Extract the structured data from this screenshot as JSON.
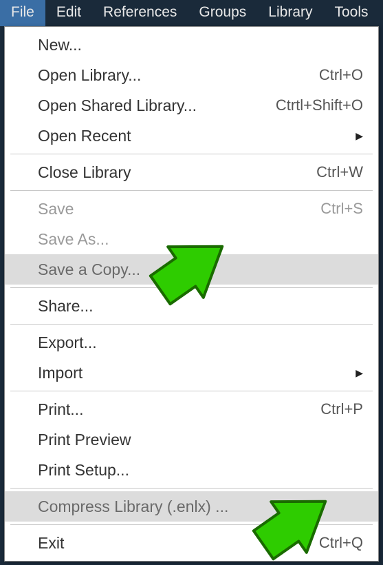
{
  "menubar": {
    "items": [
      {
        "label": "File",
        "active": true
      },
      {
        "label": "Edit",
        "active": false
      },
      {
        "label": "References",
        "active": false
      },
      {
        "label": "Groups",
        "active": false
      },
      {
        "label": "Library",
        "active": false
      },
      {
        "label": "Tools",
        "active": false
      }
    ]
  },
  "dropdown": {
    "items": [
      {
        "label": "New...",
        "shortcut": "",
        "submenu": false,
        "disabled": false,
        "highlighted": false
      },
      {
        "label": "Open Library...",
        "shortcut": "Ctrl+O",
        "submenu": false,
        "disabled": false,
        "highlighted": false
      },
      {
        "label": "Open Shared Library...",
        "shortcut": "Ctrtl+Shift+O",
        "submenu": false,
        "disabled": false,
        "highlighted": false
      },
      {
        "label": "Open Recent",
        "shortcut": "",
        "submenu": true,
        "disabled": false,
        "highlighted": false
      },
      {
        "separator": true
      },
      {
        "label": "Close Library",
        "shortcut": "Ctrl+W",
        "submenu": false,
        "disabled": false,
        "highlighted": false
      },
      {
        "separator": true
      },
      {
        "label": "Save",
        "shortcut": "Ctrl+S",
        "submenu": false,
        "disabled": true,
        "highlighted": false
      },
      {
        "label": "Save As...",
        "shortcut": "",
        "submenu": false,
        "disabled": true,
        "highlighted": false
      },
      {
        "label": "Save a Copy...",
        "shortcut": "",
        "submenu": false,
        "disabled": false,
        "highlighted": true
      },
      {
        "separator": true
      },
      {
        "label": "Share...",
        "shortcut": "",
        "submenu": false,
        "disabled": false,
        "highlighted": false
      },
      {
        "separator": true
      },
      {
        "label": "Export...",
        "shortcut": "",
        "submenu": false,
        "disabled": false,
        "highlighted": false
      },
      {
        "label": "Import",
        "shortcut": "",
        "submenu": true,
        "disabled": false,
        "highlighted": false
      },
      {
        "separator": true
      },
      {
        "label": "Print...",
        "shortcut": "Ctrl+P",
        "submenu": false,
        "disabled": false,
        "highlighted": false
      },
      {
        "label": "Print Preview",
        "shortcut": "",
        "submenu": false,
        "disabled": false,
        "highlighted": false
      },
      {
        "label": "Print Setup...",
        "shortcut": "",
        "submenu": false,
        "disabled": false,
        "highlighted": false
      },
      {
        "separator": true
      },
      {
        "label": "Compress Library (.enlx) ...",
        "shortcut": "",
        "submenu": false,
        "disabled": false,
        "highlighted": true
      },
      {
        "separator": true
      },
      {
        "label": "Exit",
        "shortcut": "Ctrl+Q",
        "submenu": false,
        "disabled": false,
        "highlighted": false
      }
    ]
  },
  "annotations": {
    "arrow1_target": "Save a Copy...",
    "arrow2_target": "Compress Library (.enlx) ..."
  }
}
